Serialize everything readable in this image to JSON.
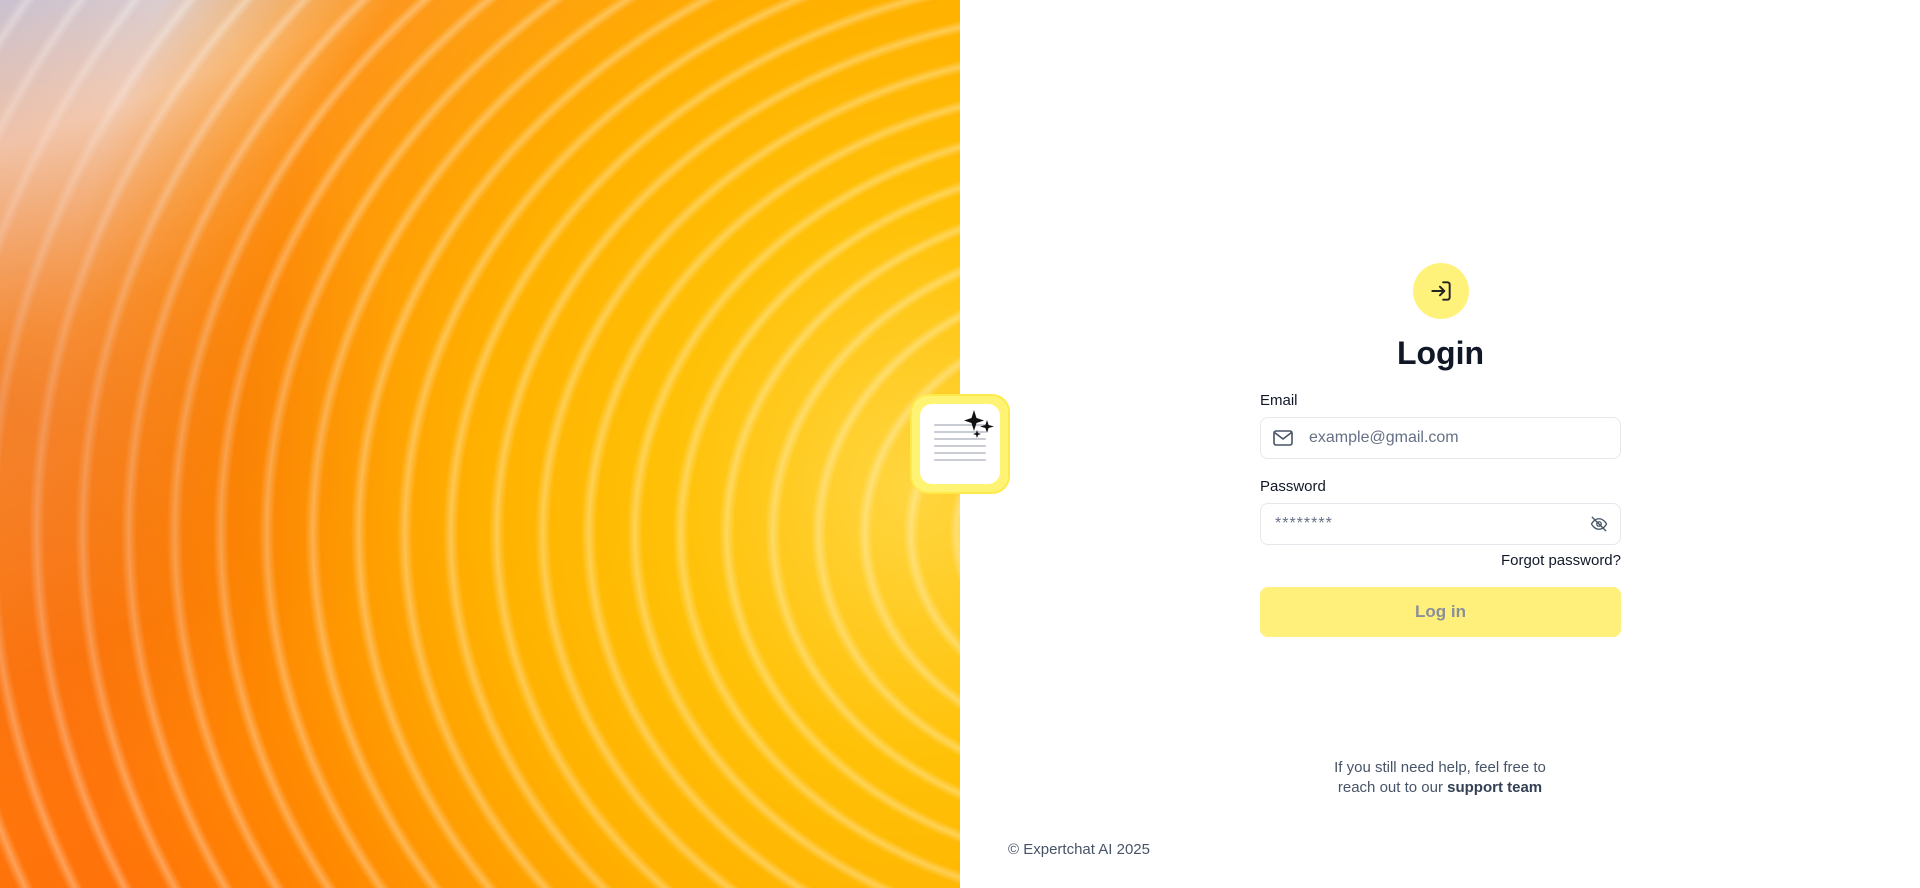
{
  "login": {
    "title": "Login",
    "email_label": "Email",
    "email_placeholder": "example@gmail.com",
    "password_label": "Password",
    "password_placeholder": "********",
    "forgot_password": "Forgot password?",
    "submit_label": "Log in"
  },
  "help": {
    "line1": "If you still need help, feel free to",
    "line2_prefix": "reach out to our ",
    "support_link": "support team"
  },
  "footer": {
    "copyright": "© Expertchat AI 2025"
  },
  "colors": {
    "accent": "#fef07a",
    "icon_circle": "#fff27a",
    "hero_primary": "#ffc107",
    "hero_secondary": "#ff7a10"
  },
  "icons": {
    "logo": "sparkle-document-icon",
    "login": "login-arrow-icon",
    "email": "mail-icon",
    "password_toggle": "eye-off-icon"
  }
}
